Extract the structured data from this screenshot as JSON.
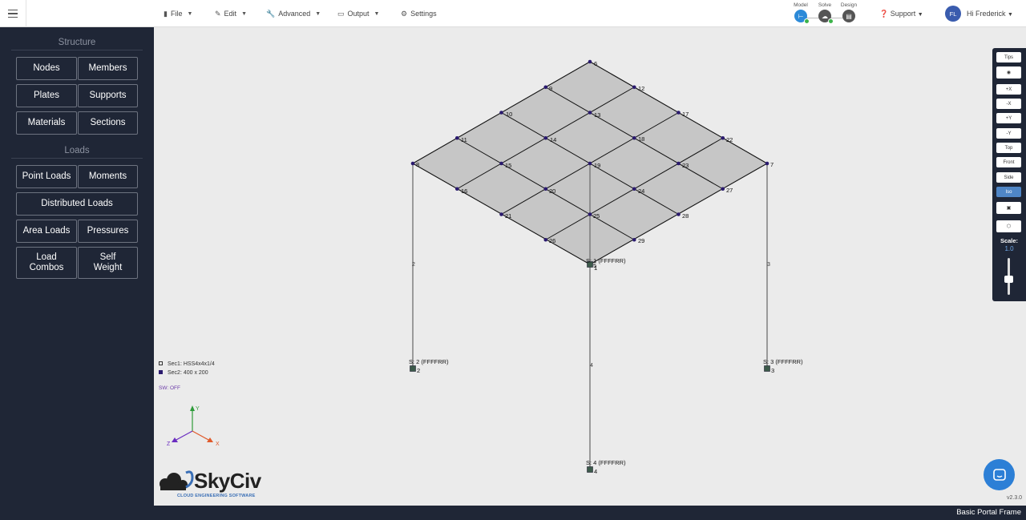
{
  "topbar": {
    "menus": [
      {
        "label": "File",
        "icon": "file-icon"
      },
      {
        "label": "Edit",
        "icon": "pencil-icon"
      },
      {
        "label": "Advanced",
        "icon": "wrench-icon"
      },
      {
        "label": "Output",
        "icon": "monitor-icon"
      },
      {
        "label": "Settings",
        "icon": "gear-icon"
      }
    ],
    "steps": [
      {
        "label": "Model",
        "color": "#2c8ad8"
      },
      {
        "label": "Solve",
        "color": "#555555"
      },
      {
        "label": "Design",
        "color": "#555555"
      }
    ],
    "support_label": "Support",
    "user_initials": "FL",
    "user_greeting": "Hi Frederick"
  },
  "sidebar": {
    "structure_title": "Structure",
    "structure_buttons": [
      "Nodes",
      "Members",
      "Plates",
      "Supports",
      "Materials",
      "Sections"
    ],
    "loads_title": "Loads",
    "loads_buttons": {
      "point_loads": "Point Loads",
      "moments": "Moments",
      "distributed_loads": "Distributed Loads",
      "area_loads": "Area Loads",
      "pressures": "Pressures",
      "load_combos": "Load Combos",
      "self_weight": "Self Weight"
    }
  },
  "model": {
    "node_labels": [
      "6",
      "9",
      "12",
      "10",
      "13",
      "17",
      "11",
      "14",
      "18",
      "22",
      "8",
      "15",
      "19",
      "23",
      "7",
      "16",
      "20",
      "24",
      "27",
      "21",
      "25",
      "28",
      "26",
      "29",
      "1",
      "5"
    ],
    "member_labels": [
      "2",
      "3",
      "4"
    ],
    "supports": [
      {
        "label": "S: 1 (FFFFRR)",
        "node": "1"
      },
      {
        "label": "S: 2 (FFFFRR)",
        "node": "2"
      },
      {
        "label": "S: 3 (FFFFRR)",
        "node": "3"
      },
      {
        "label": "S: 4 (FFFFRR)",
        "node": "4"
      }
    ]
  },
  "legend": {
    "sec1": "Sec1: HSS4x4x1/4",
    "sec2": "Sec2: 400 x 200",
    "sec2_color": "#2a1a6e",
    "sw": "SW: OFF"
  },
  "axes": {
    "x": "X",
    "y": "Y",
    "z": "Z",
    "x_color": "#e05a2b",
    "y_color": "#2e9b3a",
    "z_color": "#6a2cc0"
  },
  "toolbar": {
    "buttons": [
      "Tips",
      "eye-icon",
      "+X",
      "-X",
      "+Y",
      "-Y",
      "Top",
      "Front",
      "Side",
      "Iso",
      "camera-icon",
      "cube-icon"
    ],
    "active": "Iso",
    "scale_label": "Scale:",
    "scale_value": "1.0"
  },
  "brand": {
    "name": "SkyCiv",
    "tagline": "CLOUD ENGINEERING SOFTWARE"
  },
  "version": "v2.3.0",
  "model_name": "Basic Portal Frame"
}
